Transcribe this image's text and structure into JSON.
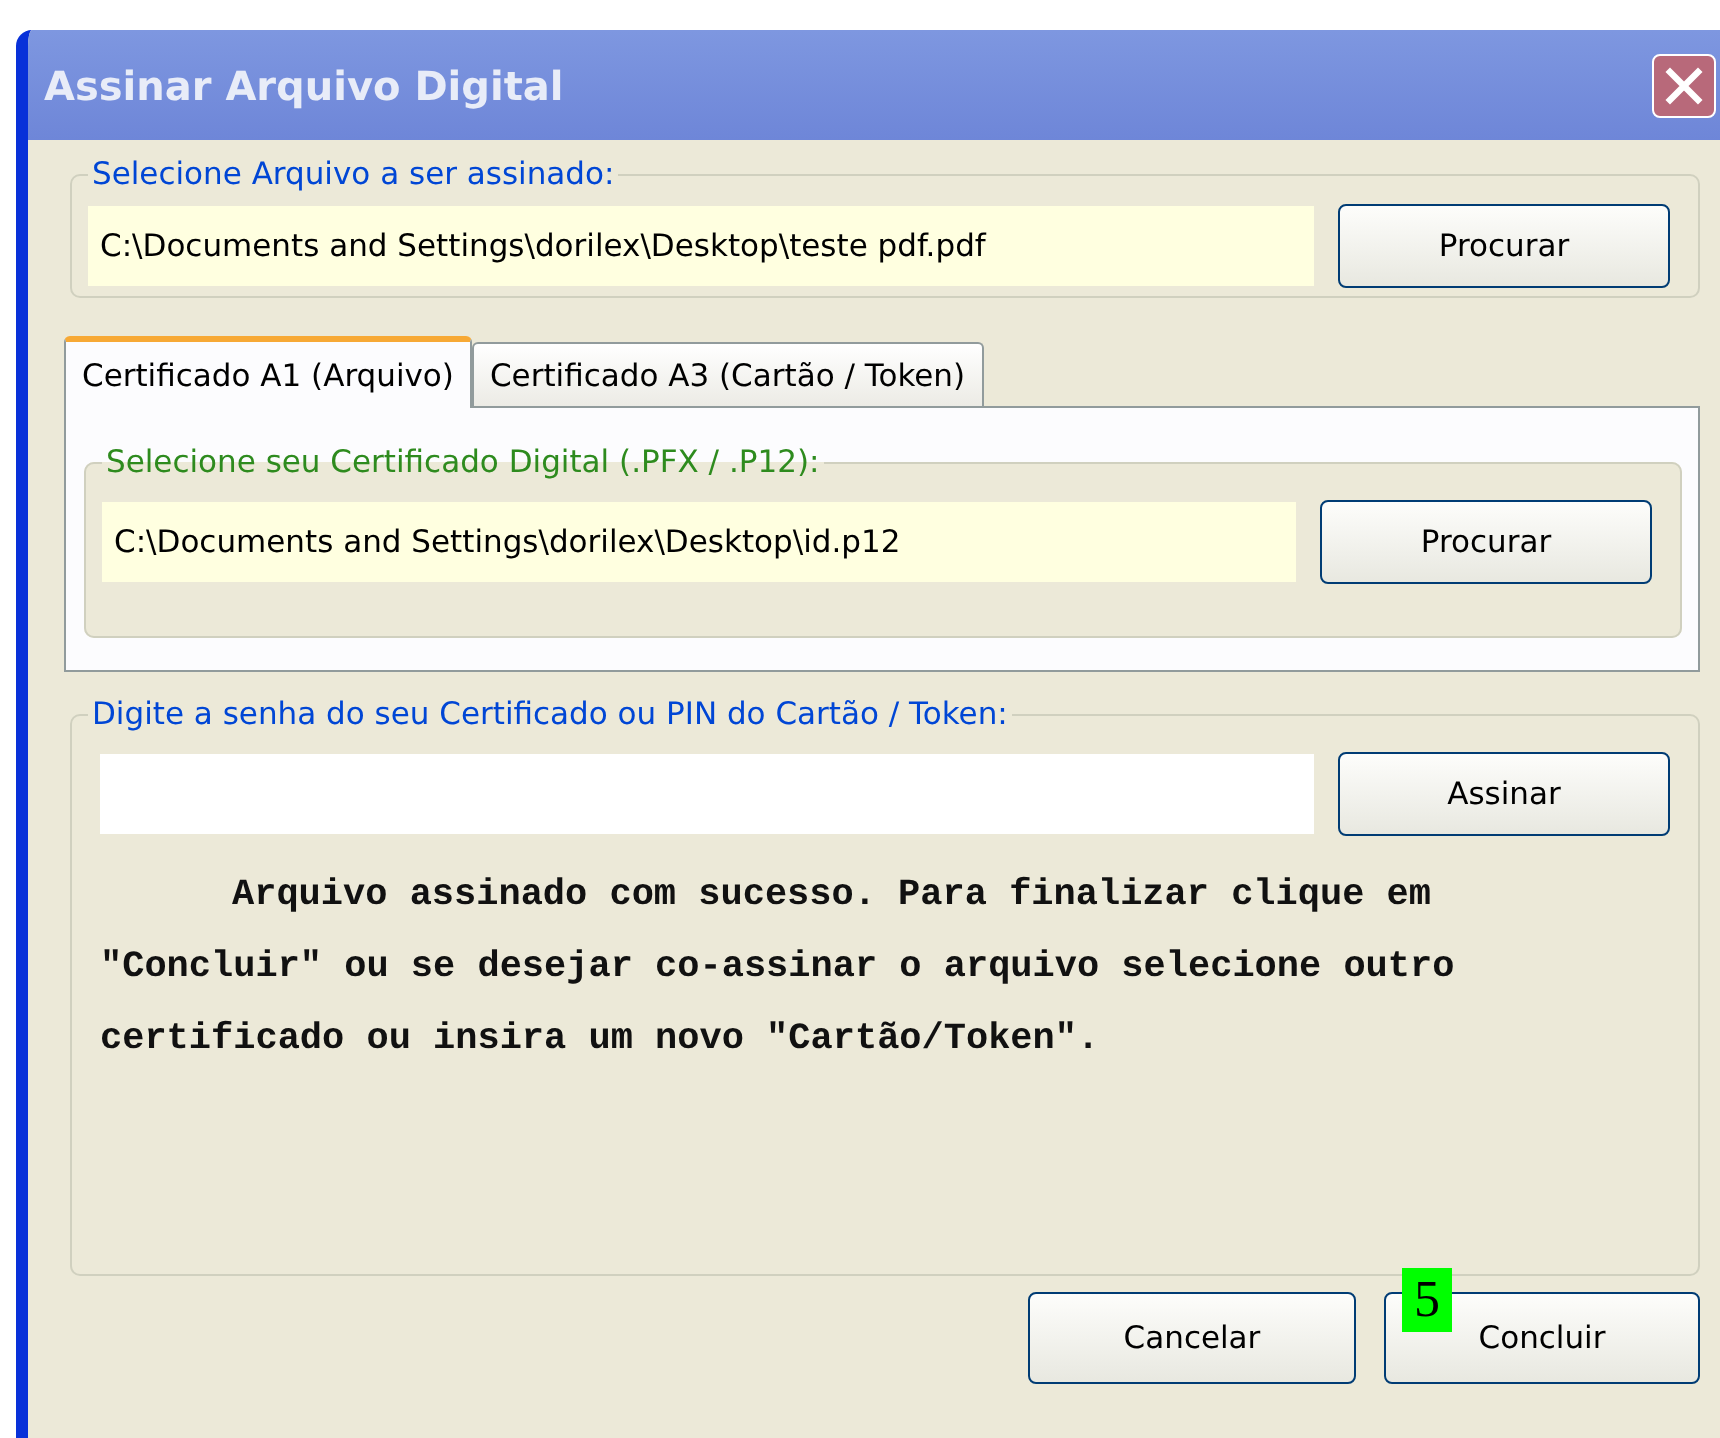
{
  "window": {
    "title": "Assinar Arquivo Digital"
  },
  "file_group": {
    "legend": "Selecione Arquivo a ser assinado:",
    "path": "C:\\Documents and Settings\\dorilex\\Desktop\\teste pdf.pdf",
    "button": "Procurar"
  },
  "tabs": [
    {
      "label": "Certificado A1 (Arquivo)",
      "selected": true
    },
    {
      "label": "Certificado A3 (Cartão / Token)",
      "selected": false
    }
  ],
  "certificate_group": {
    "legend": "Selecione seu Certificado Digital (.PFX / .P12):",
    "path": "C:\\Documents and Settings\\dorilex\\Desktop\\id.p12",
    "button": "Procurar"
  },
  "password_group": {
    "legend": "Digite a senha do seu Certificado ou PIN do Cartão / Token:",
    "button": "Assinar",
    "message": "Arquivo assinado com sucesso. Para finalizar clique em \"Concluir\" ou se desejar co-assinar o arquivo selecione outro certificado ou insira um novo \"Cartão/Token\"."
  },
  "buttons": [
    "Cancelar",
    "Concluir"
  ],
  "marker": "5"
}
